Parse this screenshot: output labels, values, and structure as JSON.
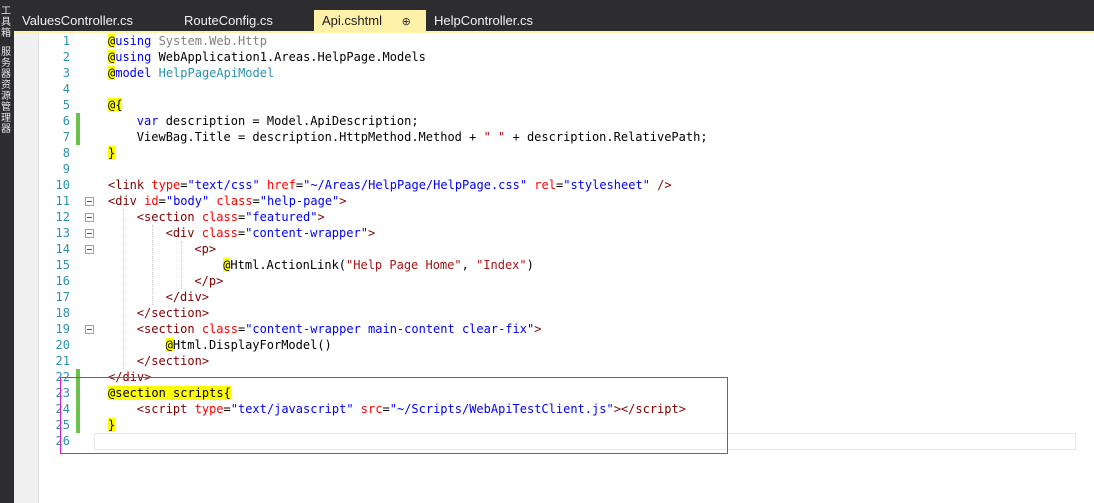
{
  "side_panel": {
    "items": [
      "工具箱",
      "服务器资源管理器"
    ]
  },
  "tabs": [
    {
      "label": "ValuesController.cs",
      "active": false
    },
    {
      "label": "RouteConfig.cs",
      "active": false
    },
    {
      "label": "Api.cshtml",
      "active": true,
      "pin": "⊕"
    },
    {
      "label": "HelpController.cs",
      "active": false
    }
  ],
  "colors": {
    "keyword": "#0000ff",
    "razor_bg": "#ffff00",
    "tag": "#800000",
    "attr": "#ff0000",
    "string": "#a31515",
    "type": "#2b91af",
    "line_number": "#2b91af",
    "changed": "#6ac14e",
    "selection": "#d21bd2"
  },
  "code_lines": [
    {
      "n": "1",
      "chg": false,
      "fold": false,
      "indent": 0,
      "t": [
        [
          "@",
          "razor"
        ],
        [
          "using",
          "kw"
        ],
        [
          " System.Web.Http",
          "gray"
        ]
      ]
    },
    {
      "n": "2",
      "chg": false,
      "fold": false,
      "indent": 0,
      "t": [
        [
          "@",
          "razor"
        ],
        [
          "using",
          "kw"
        ],
        [
          " WebApplication1.Areas.HelpPage.Models",
          "plain"
        ]
      ]
    },
    {
      "n": "3",
      "chg": false,
      "fold": false,
      "indent": 0,
      "t": [
        [
          "@",
          "razor"
        ],
        [
          "model",
          "kw"
        ],
        [
          " ",
          "plain"
        ],
        [
          "HelpPageApiModel",
          "type"
        ]
      ]
    },
    {
      "n": "4",
      "chg": false,
      "fold": false,
      "indent": 0,
      "t": []
    },
    {
      "n": "5",
      "chg": false,
      "fold": false,
      "indent": 0,
      "t": [
        [
          "@{",
          "razor"
        ]
      ]
    },
    {
      "n": "6",
      "chg": true,
      "fold": false,
      "indent": 4,
      "t": [
        [
          "var",
          "kw"
        ],
        [
          " description = Model.ApiDescription;",
          "plain"
        ]
      ]
    },
    {
      "n": "7",
      "chg": true,
      "fold": false,
      "indent": 4,
      "t": [
        [
          "ViewBag.Title = description.HttpMethod.Method + ",
          "plain"
        ],
        [
          "\" \"",
          "str"
        ],
        [
          " + description.RelativePath;",
          "plain"
        ]
      ]
    },
    {
      "n": "8",
      "chg": false,
      "fold": false,
      "indent": 0,
      "t": [
        [
          "}",
          "razor"
        ]
      ]
    },
    {
      "n": "9",
      "chg": false,
      "fold": false,
      "indent": 0,
      "t": []
    },
    {
      "n": "10",
      "chg": false,
      "fold": false,
      "indent": 0,
      "t": [
        [
          "<",
          "tag"
        ],
        [
          "link",
          "tag"
        ],
        [
          " type",
          "attr"
        ],
        [
          "=",
          "plain"
        ],
        [
          "\"text/css\"",
          "kw"
        ],
        [
          " href",
          "attr"
        ],
        [
          "=",
          "plain"
        ],
        [
          "\"~/Areas/HelpPage/HelpPage.css\"",
          "kw"
        ],
        [
          " rel",
          "attr"
        ],
        [
          "=",
          "plain"
        ],
        [
          "\"stylesheet\"",
          "kw"
        ],
        [
          " />",
          "tag"
        ]
      ]
    },
    {
      "n": "11",
      "chg": false,
      "fold": true,
      "indent": 0,
      "t": [
        [
          "<",
          "tag"
        ],
        [
          "div",
          "tag"
        ],
        [
          " id",
          "attr"
        ],
        [
          "=",
          "plain"
        ],
        [
          "\"body\"",
          "kw"
        ],
        [
          " class",
          "attr"
        ],
        [
          "=",
          "plain"
        ],
        [
          "\"help-page\"",
          "kw"
        ],
        [
          ">",
          "tag"
        ]
      ]
    },
    {
      "n": "12",
      "chg": false,
      "fold": true,
      "indent": 4,
      "t": [
        [
          "<",
          "tag"
        ],
        [
          "section",
          "tag"
        ],
        [
          " class",
          "attr"
        ],
        [
          "=",
          "plain"
        ],
        [
          "\"featured\"",
          "kw"
        ],
        [
          ">",
          "tag"
        ]
      ]
    },
    {
      "n": "13",
      "chg": false,
      "fold": true,
      "indent": 8,
      "t": [
        [
          "<",
          "tag"
        ],
        [
          "div",
          "tag"
        ],
        [
          " class",
          "attr"
        ],
        [
          "=",
          "plain"
        ],
        [
          "\"content-wrapper\"",
          "kw"
        ],
        [
          ">",
          "tag"
        ]
      ]
    },
    {
      "n": "14",
      "chg": false,
      "fold": true,
      "indent": 12,
      "t": [
        [
          "<",
          "tag"
        ],
        [
          "p",
          "tag"
        ],
        [
          ">",
          "tag"
        ]
      ]
    },
    {
      "n": "15",
      "chg": false,
      "fold": false,
      "indent": 16,
      "t": [
        [
          "@",
          "razor"
        ],
        [
          "Html.ActionLink(",
          "plain"
        ],
        [
          "\"Help Page Home\"",
          "str"
        ],
        [
          ", ",
          "plain"
        ],
        [
          "\"Index\"",
          "str"
        ],
        [
          ")",
          "plain"
        ]
      ]
    },
    {
      "n": "16",
      "chg": false,
      "fold": false,
      "indent": 12,
      "t": [
        [
          "</",
          "tag"
        ],
        [
          "p",
          "tag"
        ],
        [
          ">",
          "tag"
        ]
      ]
    },
    {
      "n": "17",
      "chg": false,
      "fold": false,
      "indent": 8,
      "t": [
        [
          "</",
          "tag"
        ],
        [
          "div",
          "tag"
        ],
        [
          ">",
          "tag"
        ]
      ]
    },
    {
      "n": "18",
      "chg": false,
      "fold": false,
      "indent": 4,
      "t": [
        [
          "</",
          "tag"
        ],
        [
          "section",
          "tag"
        ],
        [
          ">",
          "tag"
        ]
      ]
    },
    {
      "n": "19",
      "chg": false,
      "fold": true,
      "indent": 4,
      "t": [
        [
          "<",
          "tag"
        ],
        [
          "section",
          "tag"
        ],
        [
          " class",
          "attr"
        ],
        [
          "=",
          "plain"
        ],
        [
          "\"content-wrapper main-content clear-fix\"",
          "kw"
        ],
        [
          ">",
          "tag"
        ]
      ]
    },
    {
      "n": "20",
      "chg": false,
      "fold": false,
      "indent": 8,
      "t": [
        [
          "@",
          "razor"
        ],
        [
          "Html.DisplayForModel()",
          "plain"
        ]
      ]
    },
    {
      "n": "21",
      "chg": false,
      "fold": false,
      "indent": 4,
      "t": [
        [
          "</",
          "tag"
        ],
        [
          "section",
          "tag"
        ],
        [
          ">",
          "tag"
        ]
      ]
    },
    {
      "n": "22",
      "chg": true,
      "fold": false,
      "indent": 0,
      "t": [
        [
          "</",
          "tag"
        ],
        [
          "div",
          "tag"
        ],
        [
          ">",
          "tag"
        ]
      ]
    },
    {
      "n": "23",
      "chg": true,
      "fold": false,
      "indent": 0,
      "t": [
        [
          "@section scripts{",
          "razor"
        ]
      ]
    },
    {
      "n": "24",
      "chg": true,
      "fold": false,
      "indent": 4,
      "t": [
        [
          "<",
          "tag"
        ],
        [
          "script",
          "tag"
        ],
        [
          " type",
          "attr"
        ],
        [
          "=",
          "plain"
        ],
        [
          "\"text/javascript\"",
          "kw"
        ],
        [
          " src",
          "attr"
        ],
        [
          "=",
          "plain"
        ],
        [
          "\"~/Scripts/WebApiTestClient.js\"",
          "kw"
        ],
        [
          "></",
          "tag"
        ],
        [
          "script",
          "tag"
        ],
        [
          ">",
          "tag"
        ]
      ]
    },
    {
      "n": "25",
      "chg": true,
      "fold": false,
      "indent": 0,
      "t": [
        [
          "}",
          "razor"
        ]
      ]
    },
    {
      "n": "26",
      "chg": false,
      "fold": false,
      "indent": 0,
      "t": []
    }
  ]
}
